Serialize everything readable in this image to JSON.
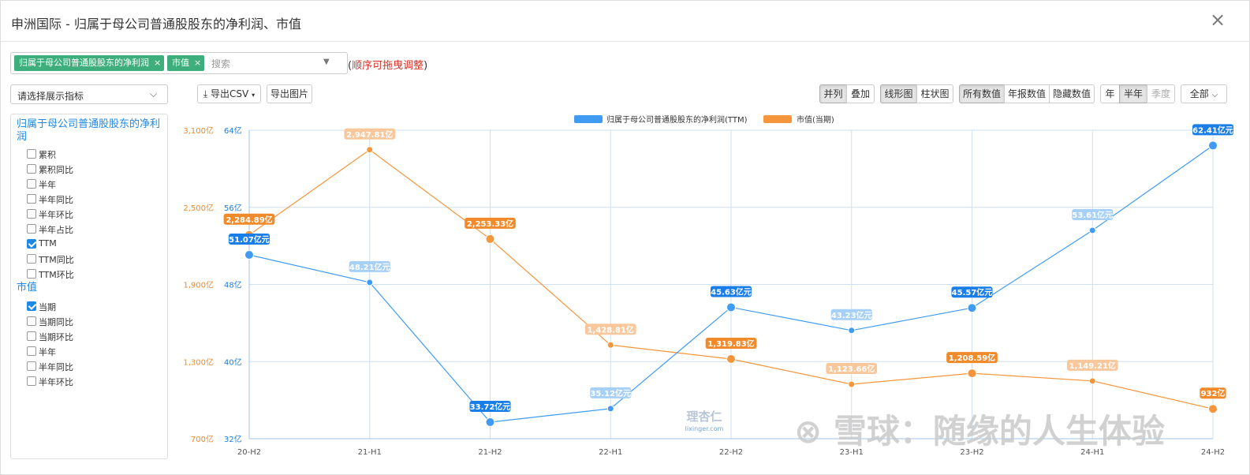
{
  "header": {
    "title": "申洲国际 - 归属于母公司普通股股东的净利润、市值",
    "close": "×"
  },
  "selector": {
    "tags": [
      "归属于母公司普通股股东的净利润",
      "市值"
    ],
    "tag_remove": "×",
    "search_placeholder": "搜索",
    "hint": "顺序可拖曳调整",
    "hint_open": "(",
    "hint_close": ")"
  },
  "dropdown": {
    "label": "请选择展示指标"
  },
  "sidebar": {
    "groups": [
      {
        "label": "归属于母公司普通股股东的净利润",
        "options": [
          {
            "label": "累积",
            "checked": false
          },
          {
            "label": "累积同比",
            "checked": false
          },
          {
            "label": "半年",
            "checked": false
          },
          {
            "label": "半年同比",
            "checked": false
          },
          {
            "label": "半年环比",
            "checked": false
          },
          {
            "label": "半年占比",
            "checked": false
          },
          {
            "label": "TTM",
            "checked": true
          },
          {
            "label": "TTM同比",
            "checked": false
          },
          {
            "label": "TTM环比",
            "checked": false
          }
        ]
      },
      {
        "label": "市值",
        "options": [
          {
            "label": "当期",
            "checked": true
          },
          {
            "label": "当期同比",
            "checked": false
          },
          {
            "label": "当期环比",
            "checked": false
          },
          {
            "label": "半年",
            "checked": false
          },
          {
            "label": "半年同比",
            "checked": false
          },
          {
            "label": "半年环比",
            "checked": false
          }
        ]
      }
    ]
  },
  "toolbar": {
    "export_csv": "导出CSV",
    "export_image": "导出图片",
    "layout_parallel": "并列",
    "layout_stack": "叠加",
    "chart_line": "线形图",
    "chart_bar": "柱状图",
    "values_all": "所有数值",
    "values_annual": "年报数值",
    "values_hide": "隐藏数值",
    "period_year": "年",
    "period_half": "半年",
    "period_quarter": "季度",
    "range_all": "全部"
  },
  "colors": {
    "blue": "#3f9cf2",
    "orange": "#f5963c",
    "blue_dark": "#1a7ee8",
    "orange_dark": "#f08a2a"
  },
  "chart_data": {
    "type": "line",
    "categories": [
      "20-H2",
      "21-H1",
      "21-H2",
      "22-H1",
      "22-H2",
      "23-H1",
      "23-H2",
      "24-H1",
      "24-H2"
    ],
    "series": [
      {
        "name": "归属于母公司普通股股东的净利润(TTM)",
        "axis": "right-inner",
        "values": [
          51.07,
          48.21,
          33.72,
          35.12,
          45.63,
          43.23,
          45.57,
          53.61,
          62.41
        ],
        "labels": [
          "51.07亿元",
          "48.21亿元",
          "33.72亿元",
          "35.12亿元",
          "45.63亿元",
          "43.23亿元",
          "45.57亿元",
          "53.61亿元",
          "62.41亿元"
        ],
        "annual": [
          true,
          false,
          true,
          false,
          true,
          false,
          true,
          false,
          true
        ]
      },
      {
        "name": "市值(当期)",
        "axis": "left-outer",
        "values": [
          2284.89,
          2947.81,
          2253.33,
          1428.81,
          1319.83,
          1123.66,
          1208.59,
          1149.21,
          932
        ],
        "labels": [
          "2,284.89亿",
          "2,947.81亿",
          "2,253.33亿",
          "1,428.81亿",
          "1,319.83亿",
          "1,123.66亿",
          "1,208.59亿",
          "1,149.21亿",
          "932亿"
        ],
        "annual": [
          true,
          false,
          true,
          false,
          true,
          false,
          true,
          false,
          true
        ]
      }
    ],
    "y_left": {
      "ticks": [
        "3,100亿",
        "2,500亿",
        "1,900亿",
        "1,300亿",
        "700亿"
      ],
      "range": [
        700,
        3100
      ]
    },
    "y_right": {
      "ticks": [
        "64亿",
        "56亿",
        "48亿",
        "40亿",
        "32亿"
      ],
      "range": [
        32,
        64
      ]
    },
    "grid": true,
    "legend": "top-center"
  },
  "watermark": {
    "logo_text": "理杏仁",
    "logo_url": "lixinger.com",
    "snow": "雪球：随缘的人生体验"
  }
}
